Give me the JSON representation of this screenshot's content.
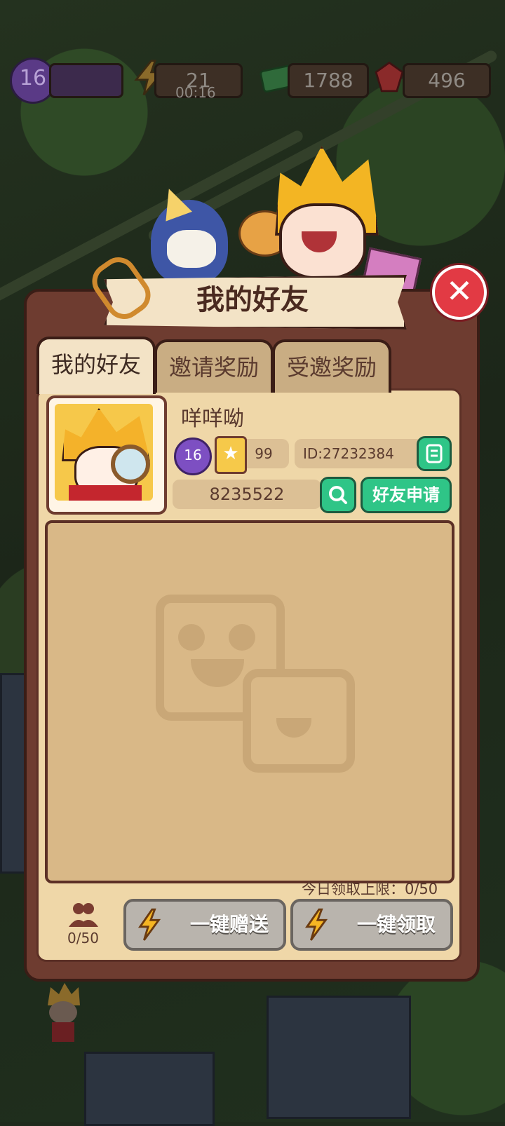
{
  "topbar": {
    "level": "16",
    "energy": "21",
    "energy_timer": "00:16",
    "cash": "1788",
    "gems": "496"
  },
  "dialog": {
    "title": "我的好友",
    "close_icon": "close-icon"
  },
  "tabs": [
    {
      "label": "我的好友",
      "active": true
    },
    {
      "label": "邀请奖励",
      "active": false
    },
    {
      "label": "受邀奖励",
      "active": false
    }
  ],
  "profile": {
    "nickname": "咩咩呦",
    "level": "16",
    "star_count": "99",
    "id_text": "ID:27232384",
    "search_value": "8235522",
    "friend_request_label": "好友申请"
  },
  "footer": {
    "daily_limit": "今日领取上限：0/50",
    "friend_count": "0/50",
    "send_all_label": "一键赠送",
    "claim_all_label": "一键领取"
  },
  "colors": {
    "panel": "#6e3c30",
    "accent_green": "#2fc587",
    "close_red": "#e23a44"
  }
}
